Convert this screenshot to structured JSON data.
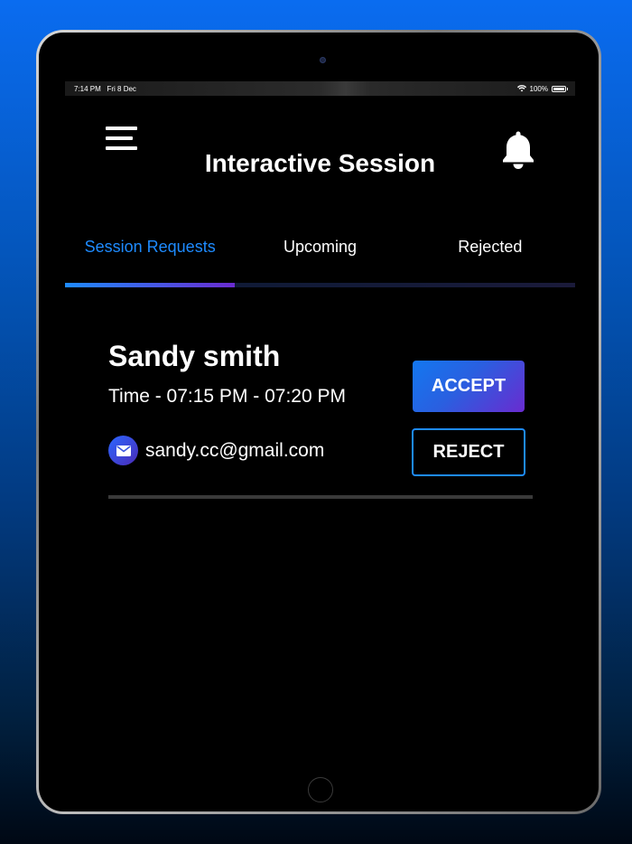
{
  "status_bar": {
    "time": "7:14 PM",
    "date": "Fri 8 Dec",
    "battery": "100%"
  },
  "header": {
    "title": "Interactive Session",
    "menu_icon": "hamburger-menu-icon",
    "bell_icon": "bell-icon"
  },
  "tabs": [
    {
      "label": "Session Requests",
      "active": true
    },
    {
      "label": "Upcoming",
      "active": false
    },
    {
      "label": "Rejected",
      "active": false
    }
  ],
  "request": {
    "name": "Sandy smith",
    "time": "Time - 07:15 PM - 07:20 PM",
    "email": "sandy.cc@gmail.com",
    "accept_label": "ACCEPT",
    "reject_label": "REJECT"
  },
  "colors": {
    "accent": "#1e8bff",
    "accent_purple": "#6a2bd0",
    "background": "#000000"
  }
}
